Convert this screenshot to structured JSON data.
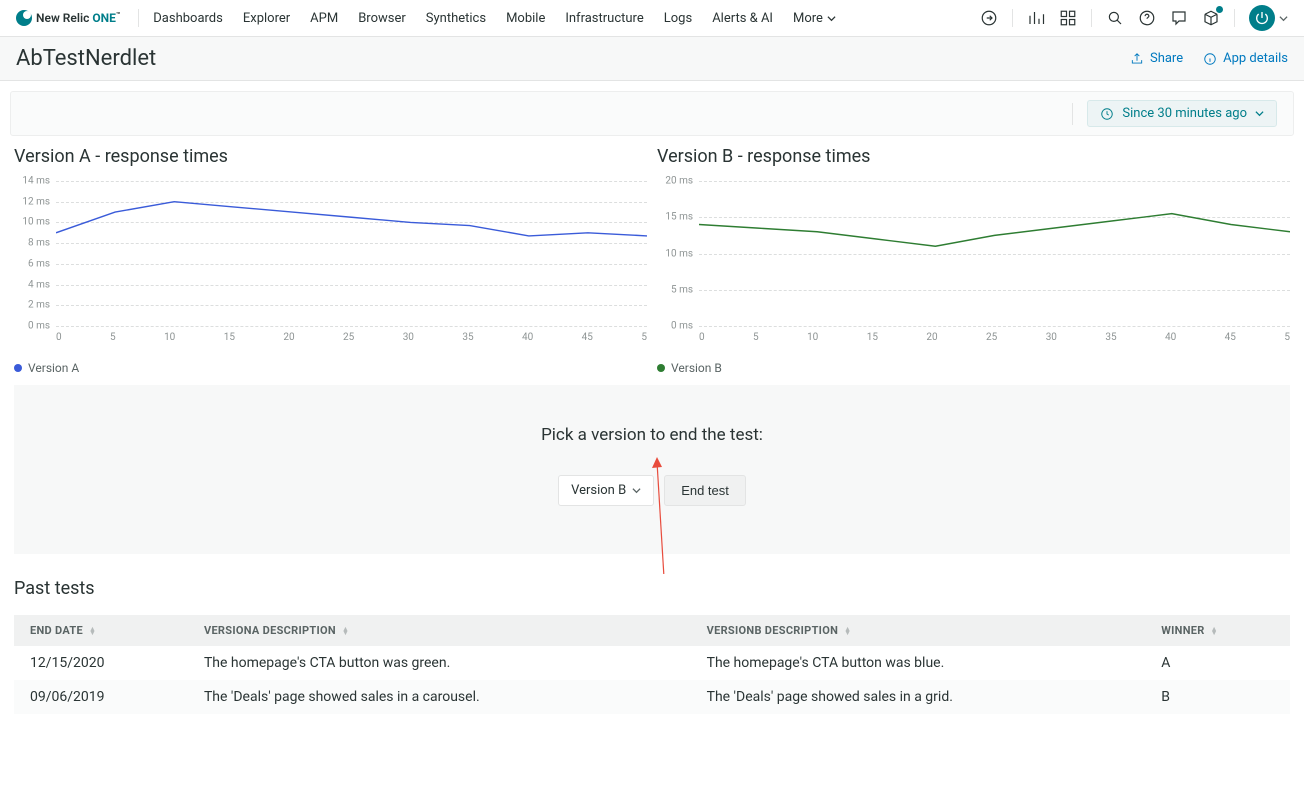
{
  "brand": {
    "text1": "New Relic ",
    "text2": "ONE",
    "tm": "™"
  },
  "nav": {
    "items": [
      "Dashboards",
      "Explorer",
      "APM",
      "Browser",
      "Synthetics",
      "Mobile",
      "Infrastructure",
      "Logs",
      "Alerts & AI"
    ],
    "more": "More"
  },
  "page": {
    "title": "AbTestNerdlet",
    "share": "Share",
    "app_details": "App details",
    "timepicker": "Since 30 minutes ago"
  },
  "chart_data": [
    {
      "type": "line",
      "title": "Version A - response times",
      "legend": "Version A",
      "color": "#3a5bd9",
      "x": [
        0,
        5,
        10,
        15,
        20,
        25,
        30,
        35,
        40,
        45,
        50
      ],
      "y": [
        9,
        11,
        12,
        11.5,
        11,
        10.5,
        10,
        9.7,
        8.7,
        9,
        8.7
      ],
      "y_ticks": [
        "0 ms",
        "2 ms",
        "4 ms",
        "6 ms",
        "8 ms",
        "10 ms",
        "12 ms",
        "14 ms"
      ],
      "y_vals": [
        0,
        2,
        4,
        6,
        8,
        10,
        12,
        14
      ],
      "ylim": [
        0,
        14
      ],
      "x_ticks": [
        "0",
        "5",
        "10",
        "15",
        "20",
        "25",
        "30",
        "35",
        "40",
        "45",
        "5"
      ]
    },
    {
      "type": "line",
      "title": "Version B - response times",
      "legend": "Version B",
      "color": "#2e7d32",
      "x": [
        0,
        5,
        10,
        15,
        20,
        25,
        30,
        35,
        40,
        45,
        50
      ],
      "y": [
        14,
        13.5,
        13,
        12,
        11,
        12.5,
        13.5,
        14.5,
        15.5,
        14,
        13
      ],
      "y_ticks": [
        "0 ms",
        "5 ms",
        "10 ms",
        "15 ms",
        "20 ms"
      ],
      "y_vals": [
        0,
        5,
        10,
        15,
        20
      ],
      "ylim": [
        0,
        20
      ],
      "x_ticks": [
        "0",
        "5",
        "10",
        "15",
        "20",
        "25",
        "30",
        "35",
        "40",
        "45",
        "5"
      ]
    }
  ],
  "end_test": {
    "heading": "Pick a version to end the test:",
    "selected": "Version B",
    "button": "End test"
  },
  "past_tests": {
    "title": "Past tests",
    "columns": [
      "END DATE",
      "VERSIONA DESCRIPTION",
      "VERSIONB DESCRIPTION",
      "WINNER"
    ],
    "rows": [
      {
        "end_date": "12/15/2020",
        "a": "The homepage's CTA button was green.",
        "b": "The homepage's CTA button was blue.",
        "winner": "A"
      },
      {
        "end_date": "09/06/2019",
        "a": "The 'Deals' page showed sales in a carousel.",
        "b": "The 'Deals' page showed sales in a grid.",
        "winner": "B"
      }
    ]
  }
}
